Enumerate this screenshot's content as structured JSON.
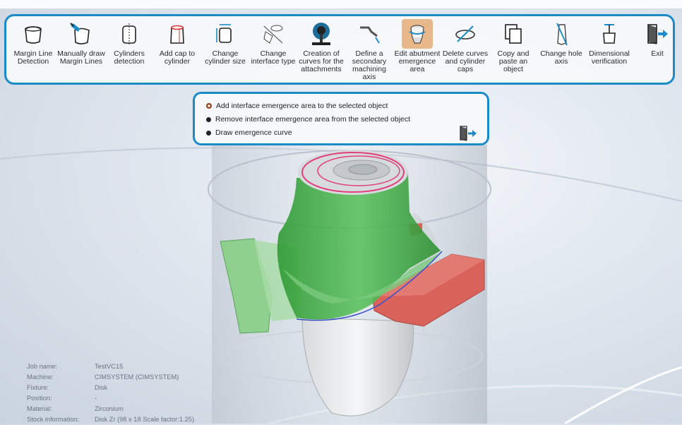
{
  "toolbar": {
    "tools": [
      {
        "label": "Margin Line\nDetection",
        "icon": "margin-line-detection-icon"
      },
      {
        "label": "Manually draw\nMargin Lines",
        "icon": "manual-margin-lines-icon"
      },
      {
        "label": "Cylinders\ndetection",
        "icon": "cylinders-detection-icon"
      },
      {
        "label": "Add cap to\ncylinder",
        "icon": "add-cap-icon"
      },
      {
        "label": "Change\ncylinder size",
        "icon": "cylinder-size-icon"
      },
      {
        "label": "Change\ninterface type",
        "icon": "interface-type-icon"
      },
      {
        "label": "Creation of\ncurves for the\nattachments",
        "icon": "attachment-curves-icon"
      },
      {
        "label": "Define a\nsecondary\nmachining axis",
        "icon": "secondary-axis-icon"
      },
      {
        "label": "Edit abutment\nemergence\narea",
        "icon": "emergence-area-icon"
      },
      {
        "label": "Delete curves\nand cylinder\ncaps",
        "icon": "delete-curves-icon"
      },
      {
        "label": "Copy and\npaste an\nobject",
        "icon": "copy-paste-icon"
      },
      {
        "label": "Change hole\naxis",
        "icon": "hole-axis-icon"
      },
      {
        "label": "Dimensional\nverification",
        "icon": "dimensional-verification-icon"
      },
      {
        "label": "Exit",
        "icon": "exit-icon"
      }
    ],
    "active_index": 8
  },
  "emergence_panel": {
    "options": [
      "Add interface emergence area to the selected object",
      "Remove interface emergence area from the selected object",
      "Draw emergence curve"
    ],
    "selected_index": 0
  },
  "info": {
    "rows": [
      {
        "label": "Job name:",
        "value": "TestVC15"
      },
      {
        "label": "Machine:",
        "value": "CIMSYSTEM (CIMSYSTEM)"
      },
      {
        "label": "Fixture:",
        "value": "Disk"
      },
      {
        "label": "Position:",
        "value": "-"
      },
      {
        "label": "Material:",
        "value": "Zirconium"
      },
      {
        "label": "Stock information:",
        "value": "Disk Zr (98 x 18 Scale factor:1.25)"
      }
    ]
  },
  "colors": {
    "accent": "#1a8bc6",
    "abutment": "#45b04a",
    "connector": "#d9635a"
  }
}
